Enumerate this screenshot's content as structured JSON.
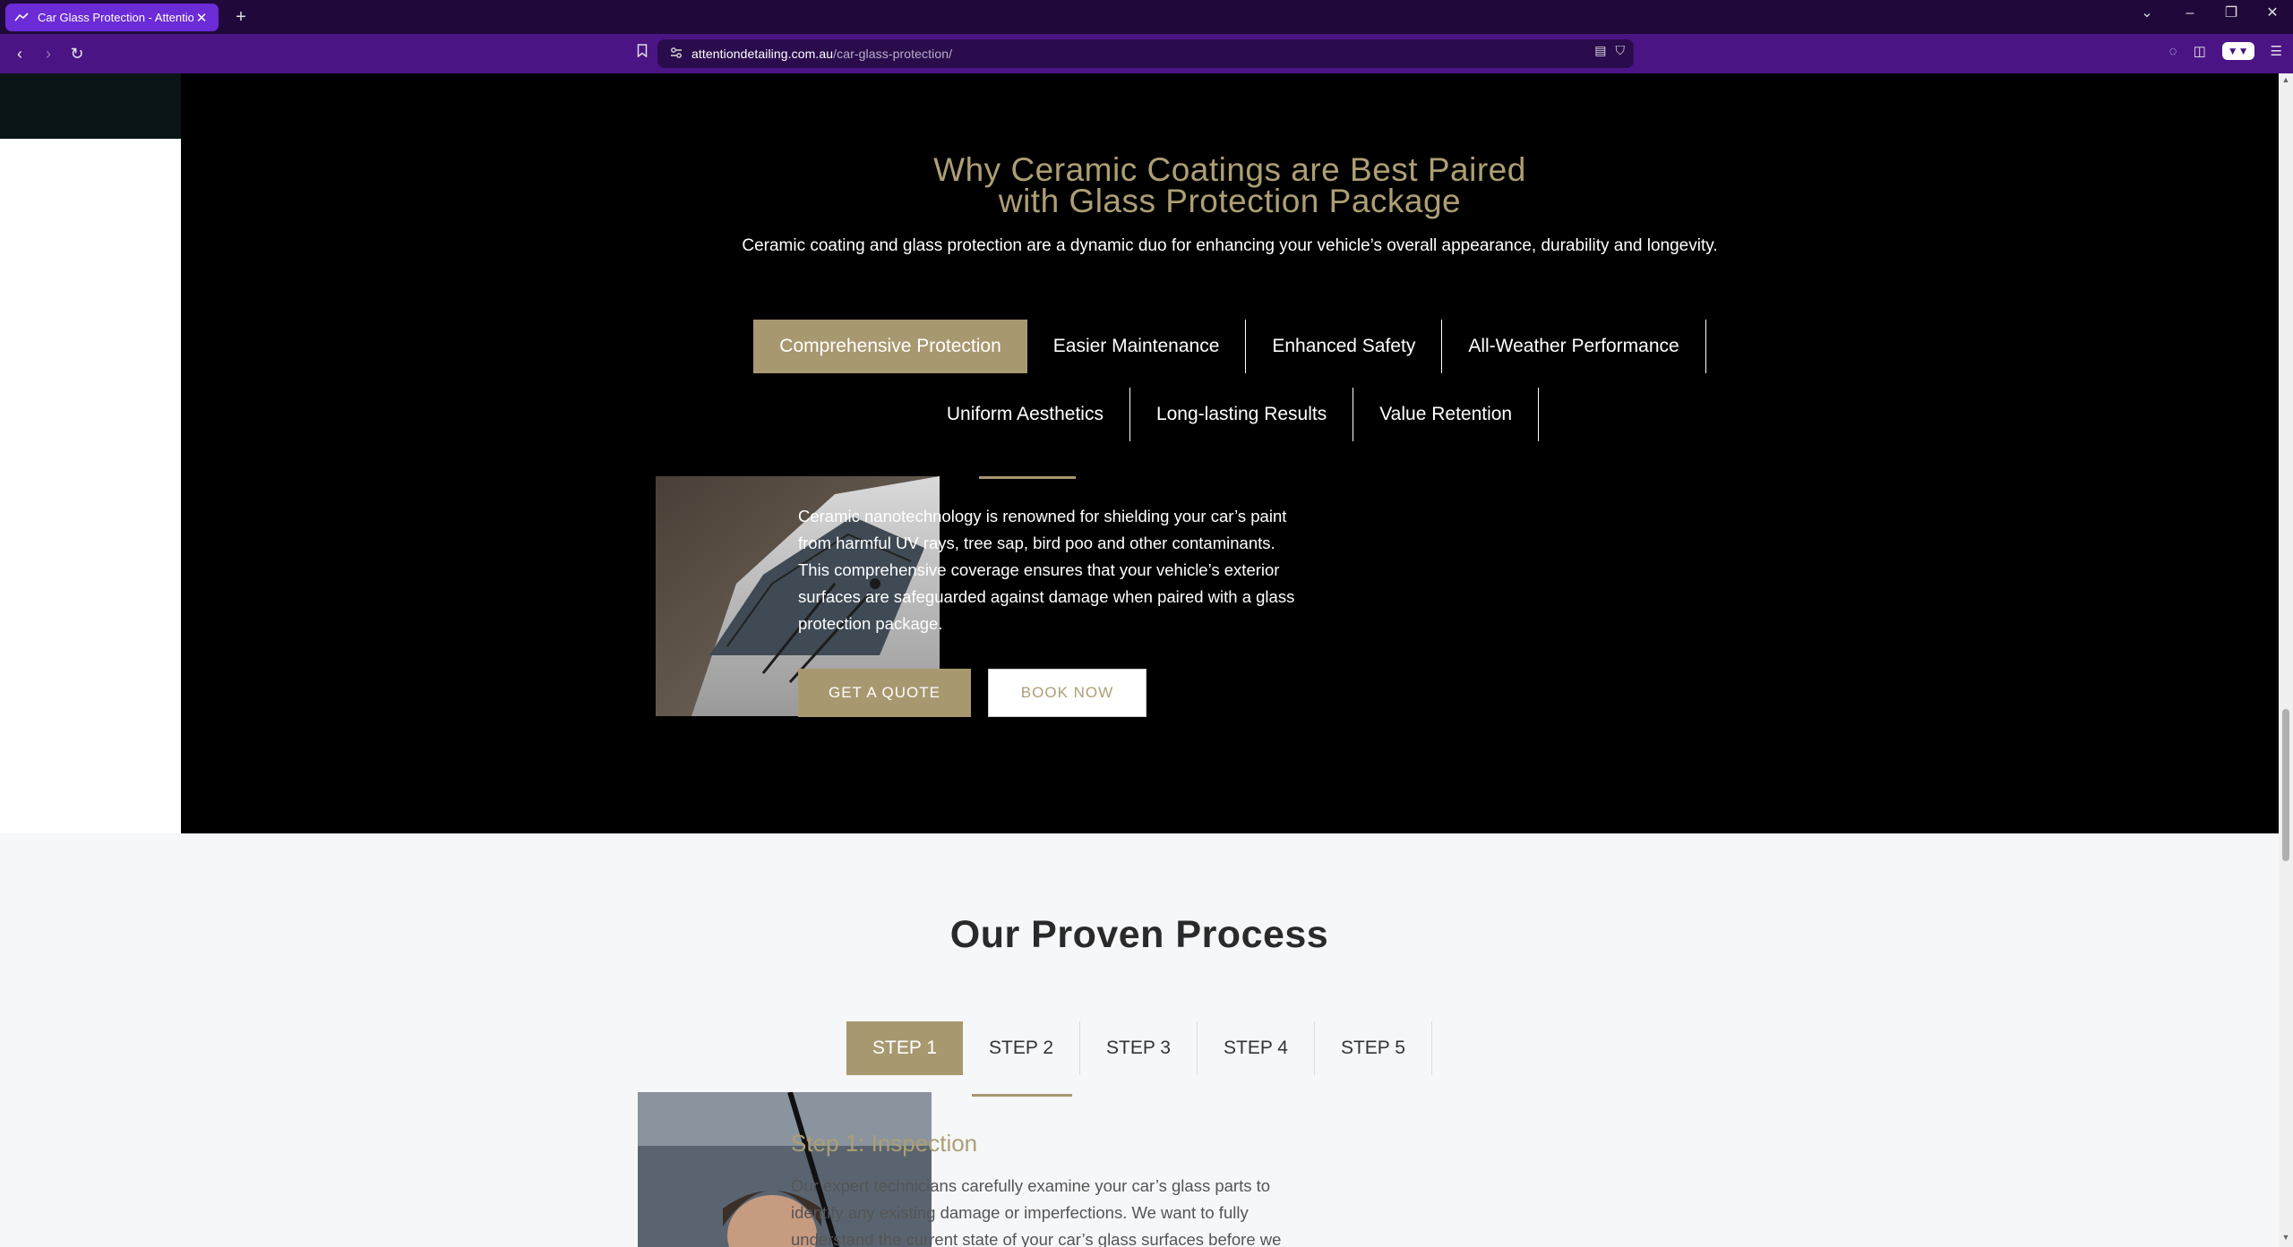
{
  "browser": {
    "tab_title": "Car Glass Protection - Attention",
    "url_domain": "attentiondetailing.com.au",
    "url_path": "/car-glass-protection/"
  },
  "benefits": {
    "heading_line1": "Why Ceramic Coatings are Best Paired",
    "heading_line2": "with Glass Protection Package",
    "intro": "Ceramic coating and glass protection are a dynamic duo for enhancing your vehicle’s overall appearance, durability and longevity.",
    "tabs_row1": [
      "Comprehensive Protection",
      "Easier Maintenance",
      "Enhanced Safety",
      "All-Weather Performance"
    ],
    "tabs_row2": [
      "Uniform Aesthetics",
      "Long-lasting Results",
      "Value Retention"
    ],
    "active_tab": "Comprehensive Protection",
    "body": "Ceramic nanotechnology is renowned for shielding your car’s paint from harmful UV rays, tree sap, bird poo and other contaminants. This comprehensive coverage ensures that your vehicle’s exterior surfaces are safeguarded against damage when paired with a glass protection package.",
    "quote_label": "GET A QUOTE",
    "book_label": "BOOK NOW"
  },
  "process": {
    "heading": "Our Proven Process",
    "steps": [
      "STEP 1",
      "STEP 2",
      "STEP 3",
      "STEP 4",
      "STEP 5"
    ],
    "active_step": "STEP 1",
    "step_title": "Step 1: Inspection",
    "step_text": "Our expert technicians carefully examine your car’s glass parts to identify any existing damage or imperfections. We want to fully understand the current state of your car’s glass surfaces before we"
  },
  "colors": {
    "accent_gold": "#a89870",
    "tab_purple": "#6b2bd6",
    "toolbar_purple": "#4b1485"
  }
}
